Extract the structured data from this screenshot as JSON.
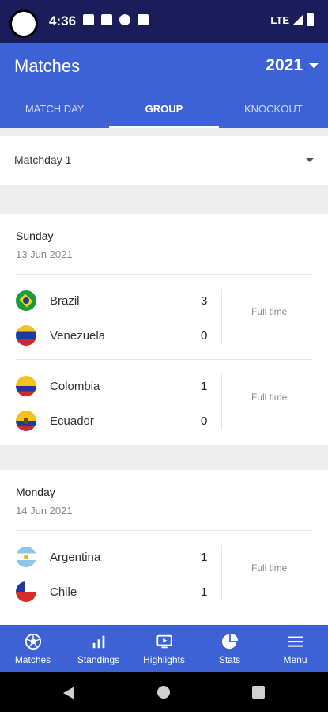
{
  "status_bar": {
    "time": "4:36",
    "network": "LTE"
  },
  "app_bar": {
    "title": "Matches",
    "year": "2021"
  },
  "tabs": [
    {
      "label": "MATCH DAY",
      "active": false
    },
    {
      "label": "GROUP",
      "active": true
    },
    {
      "label": "KNOCKOUT",
      "active": false
    }
  ],
  "matchday_select": {
    "value": "Matchday 1"
  },
  "days": [
    {
      "name": "Sunday",
      "date": "13 Jun 2021",
      "matches": [
        {
          "home": {
            "name": "Brazil",
            "score": "3"
          },
          "away": {
            "name": "Venezuela",
            "score": "0"
          },
          "status": "Full time"
        },
        {
          "home": {
            "name": "Colombia",
            "score": "1"
          },
          "away": {
            "name": "Ecuador",
            "score": "0"
          },
          "status": "Full time"
        }
      ]
    },
    {
      "name": "Monday",
      "date": "14 Jun 2021",
      "matches": [
        {
          "home": {
            "name": "Argentina",
            "score": "1"
          },
          "away": {
            "name": "Chile",
            "score": "1"
          },
          "status": "Full time"
        }
      ]
    }
  ],
  "bottom_nav": [
    {
      "label": "Matches",
      "icon": "soccer-ball-icon"
    },
    {
      "label": "Standings",
      "icon": "bar-chart-icon"
    },
    {
      "label": "Highlights",
      "icon": "video-play-icon"
    },
    {
      "label": "Stats",
      "icon": "pie-chart-icon"
    },
    {
      "label": "Menu",
      "icon": "menu-icon"
    }
  ],
  "colors": {
    "primary": "#3c62d6",
    "status_bar": "#1a1d59",
    "background": "#eeeeee"
  }
}
